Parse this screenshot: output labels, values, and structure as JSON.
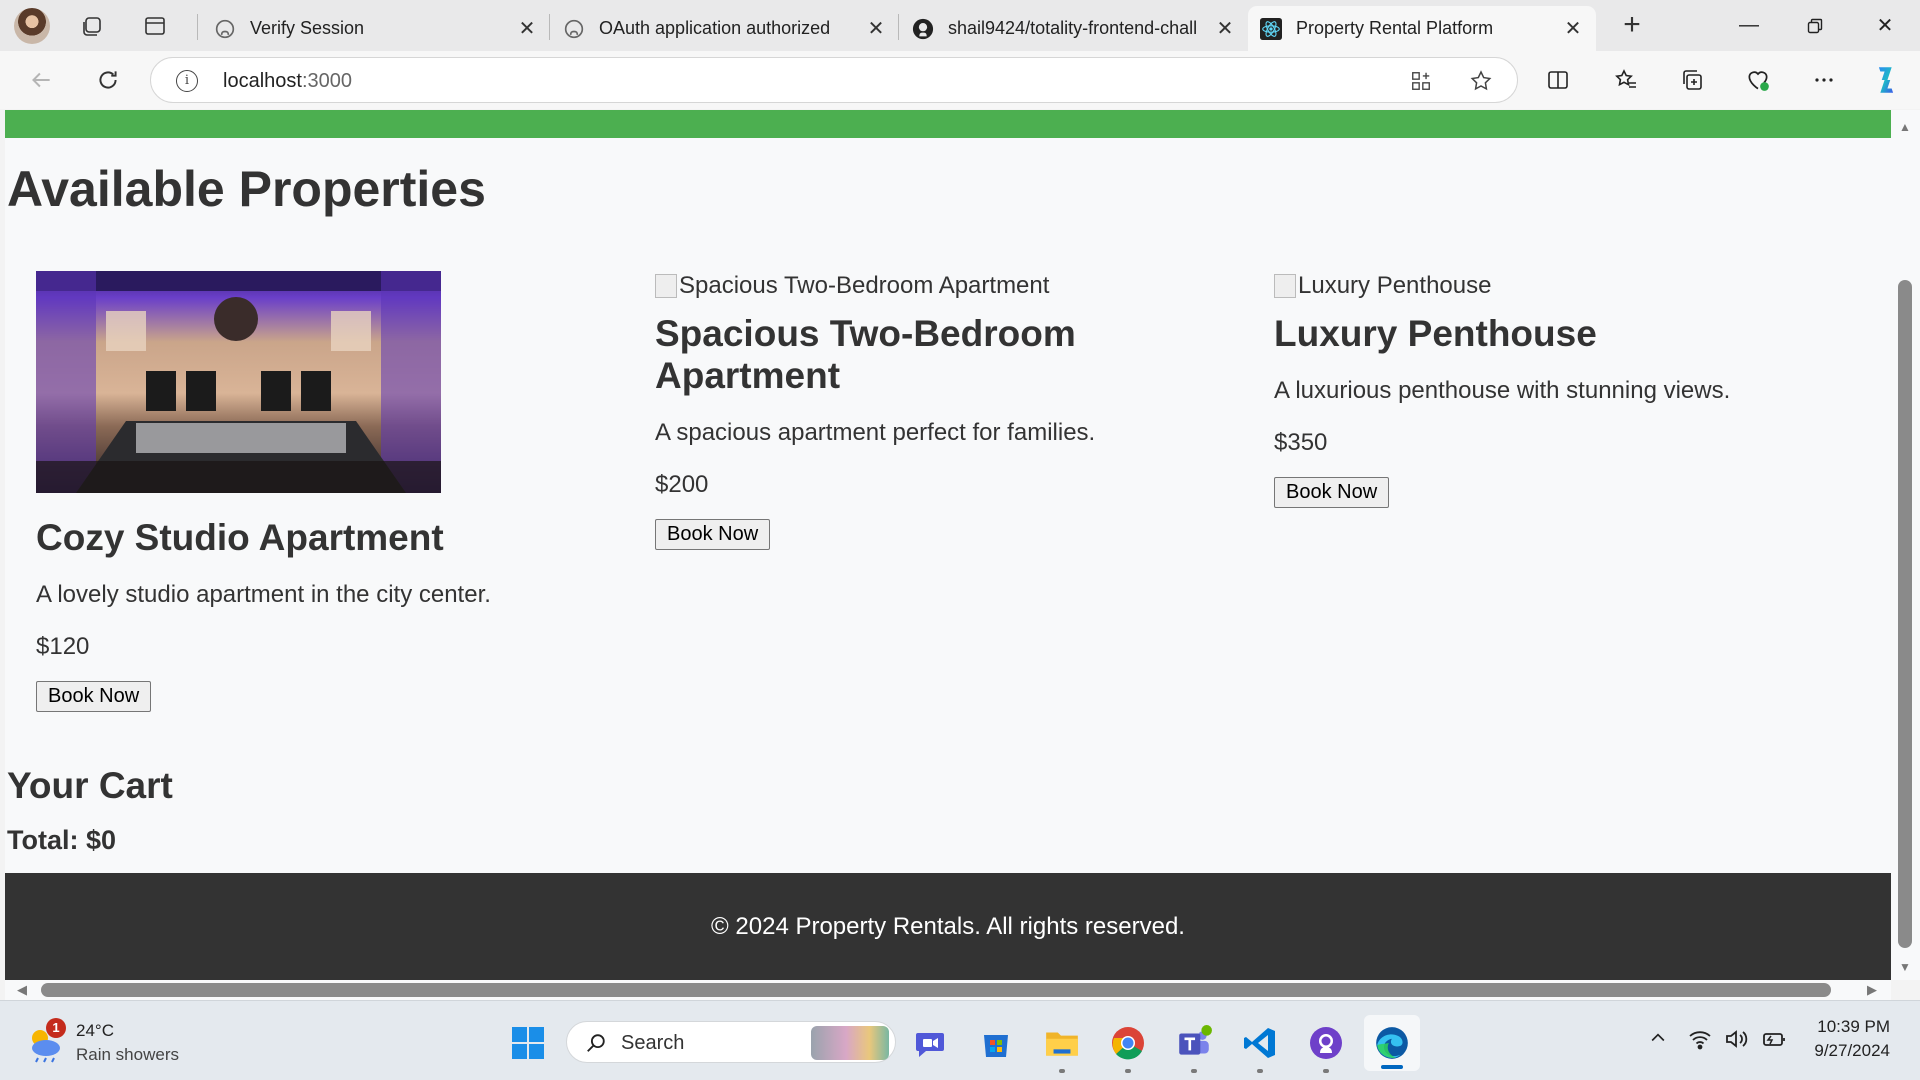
{
  "browser": {
    "tabs": [
      {
        "title": "Verify Session",
        "favicon": "github-icon"
      },
      {
        "title": "OAuth application authorized",
        "favicon": "github-icon"
      },
      {
        "title": "shail9424/totality-frontend-chall",
        "favicon": "github-icon"
      },
      {
        "title": "Property Rental Platform",
        "favicon": "react-icon",
        "active": true
      }
    ],
    "address": {
      "host": "localhost",
      "port": ":3000"
    }
  },
  "page": {
    "title": "Available Properties",
    "properties": [
      {
        "name": "Cozy Studio Apartment",
        "image_alt": "Cozy Studio Apartment",
        "description": "A lovely studio apartment in the city center.",
        "price": "$120",
        "button": "Book Now",
        "image_loaded": true
      },
      {
        "name": "Spacious Two-Bedroom Apartment",
        "image_alt": "Spacious Two-Bedroom Apartment",
        "description": "A spacious apartment perfect for families.",
        "price": "$200",
        "button": "Book Now",
        "image_loaded": false
      },
      {
        "name": "Luxury Penthouse",
        "image_alt": "Luxury Penthouse",
        "description": "A luxurious penthouse with stunning views.",
        "price": "$350",
        "button": "Book Now",
        "image_loaded": false
      }
    ],
    "cart": {
      "title": "Your Cart",
      "total": "Total: $0"
    },
    "footer": "© 2024 Property Rentals. All rights reserved."
  },
  "colors": {
    "header_bar": "#4caf50",
    "footer_bg": "#333333",
    "page_bg": "#f8f9fa"
  },
  "taskbar": {
    "weather": {
      "temp": "24°C",
      "condition": "Rain showers",
      "badge": "1"
    },
    "search_label": "Search",
    "clock": {
      "time": "10:39 PM",
      "date": "9/27/2024"
    }
  }
}
